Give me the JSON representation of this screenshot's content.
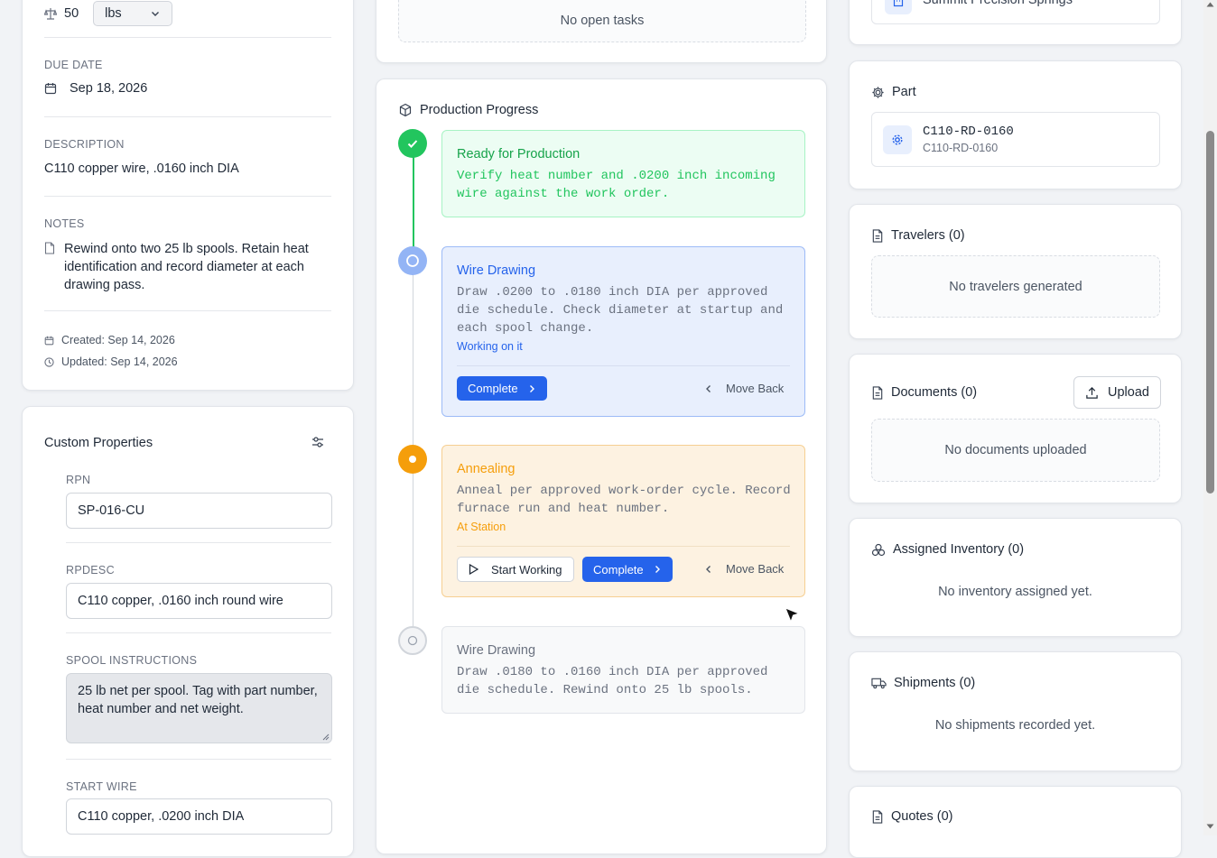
{
  "left": {
    "qty_value": "50",
    "qty_unit": "lbs",
    "due_date_label": "DUE DATE",
    "due_date": "Sep 18, 2026",
    "description_label": "DESCRIPTION",
    "description": "C110 copper wire, .0160 inch DIA",
    "notes_label": "NOTES",
    "notes": "Rewind onto two 25 lb spools. Retain heat identification and record diameter at each drawing pass.",
    "created": "Created: Sep 14, 2026",
    "updated": "Updated: Sep 14, 2026"
  },
  "custom_properties": {
    "title": "Custom Properties",
    "fields": [
      {
        "label": "RPN",
        "value": "SP-016-CU"
      },
      {
        "label": "RPDESC",
        "value": "C110 copper, .0160 inch round wire"
      },
      {
        "label": "SPOOL INSTRUCTIONS",
        "value": "25 lb net per spool. Tag with part number, heat number and net weight."
      },
      {
        "label": "START WIRE",
        "value": "C110 copper, .0200 inch DIA"
      }
    ]
  },
  "tasks": {
    "empty": "No open tasks"
  },
  "progress": {
    "title": "Production Progress",
    "steps": [
      {
        "name": "Ready for Production",
        "desc": "Verify heat number and .0200 inch incoming wire against the work order.",
        "state": "done",
        "color": "#16a34a"
      },
      {
        "name": "Wire Drawing",
        "desc": "Draw .0200 to .0180 inch DIA per approved die schedule. Check diameter at startup and each spool change.",
        "status": "Working on it",
        "state": "active",
        "color": "#2563eb",
        "complete_label": "Complete",
        "back_label": "Move Back"
      },
      {
        "name": "Annealing",
        "desc": "Anneal per approved work-order cycle. Record furnace run and heat number.",
        "status": "At Station",
        "state": "station",
        "color": "#f59e0b",
        "start_label": "Start Working",
        "complete_label": "Complete",
        "back_label": "Move Back"
      },
      {
        "name": "Wire Drawing",
        "desc": "Draw .0180 to .0160 inch DIA per approved die schedule. Rewind onto 25 lb spools.",
        "state": "pending",
        "color": "#9ca3af"
      }
    ]
  },
  "right": {
    "customer_name": "Summit Precision Springs",
    "part_title": "Part",
    "part_number": "C110-RD-0160",
    "part_sub": "C110-RD-0160",
    "travelers_title": "Travelers (0)",
    "travelers_empty": "No travelers generated",
    "documents_title": "Documents (0)",
    "upload_label": "Upload",
    "documents_empty": "No documents uploaded",
    "inventory_title": "Assigned Inventory (0)",
    "inventory_empty": "No inventory assigned yet.",
    "shipments_title": "Shipments (0)",
    "shipments_empty": "No shipments recorded yet.",
    "quotes_title": "Quotes (0)"
  }
}
